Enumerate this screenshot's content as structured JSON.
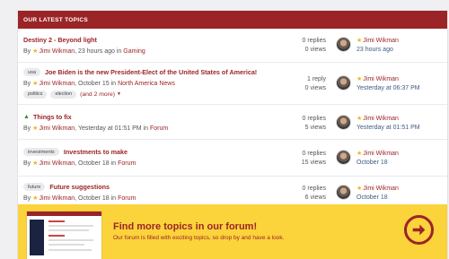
{
  "widget": {
    "header": "Our Latest Topics",
    "by_label": "By",
    "in_label": "in"
  },
  "topics": [
    {
      "title": "Destiny 2 - Beyond light",
      "author": "Jimi Wikman",
      "date": "23 hours ago",
      "forum": "Gaming",
      "replies": "0 replies",
      "views": "0 views",
      "last_user": "Jimi Wikman",
      "last_time": "23 hours ago"
    },
    {
      "prefix": "usa",
      "title": "Joe Biden is the new President-Elect of the United States of America!",
      "author": "Jimi Wikman",
      "date": "October 15",
      "forum": "North America News",
      "tags": [
        "politics",
        "election"
      ],
      "more_tags": "(and 2 more)",
      "replies": "1 reply",
      "views": "0 views",
      "last_user": "Jimi Wikman",
      "last_time": "Yesterday at 06:37 PM"
    },
    {
      "pinned": true,
      "title": "Things to fix",
      "author": "Jimi Wikman",
      "date": "Yesterday at 01:51 PM",
      "forum": "Forum",
      "replies": "0 replies",
      "views": "5 views",
      "last_user": "Jimi Wikman",
      "last_time": "Yesterday at 01:51 PM"
    },
    {
      "prefix": "investments",
      "title": "Investments to make",
      "author": "Jimi Wikman",
      "date": "October 18",
      "forum": "Forum",
      "replies": "0 replies",
      "views": "15 views",
      "last_user": "Jimi Wikman",
      "last_time": "October 18"
    },
    {
      "prefix": "future",
      "title": "Future suggestions",
      "author": "Jimi Wikman",
      "date": "October 18",
      "forum": "Forum",
      "replies": "0 replies",
      "views": "6 views",
      "last_user": "Jimi Wikman",
      "last_time": "October 18"
    }
  ],
  "cta": {
    "title": "Find more topics in our forum!",
    "text": "Our forum is filled with exciting topics, so drop by and have a look."
  },
  "icons": {
    "star": "star-icon",
    "pin": "pin-icon",
    "arrow": "arrow-right-circle-icon"
  },
  "colors": {
    "brand": "#9b2427",
    "cta_background": "#fbd33b",
    "star": "#f2b51b"
  }
}
